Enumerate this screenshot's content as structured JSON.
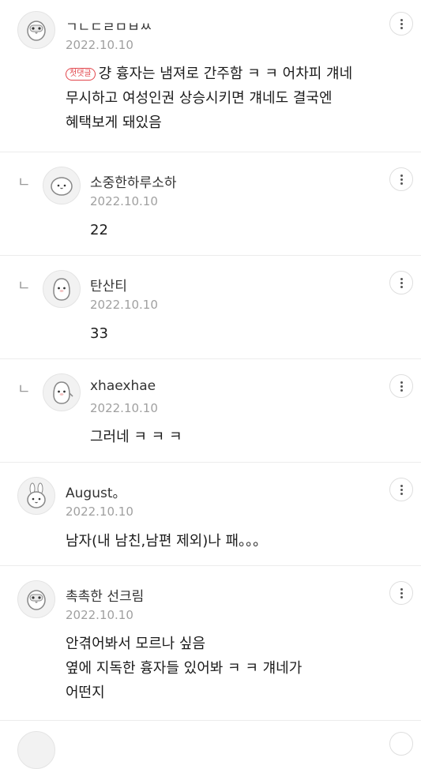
{
  "comments": [
    {
      "nick": "ㄱㄴㄷㄹㅁㅂㅆ",
      "date": "2022.10.10",
      "badge": "첫댓글",
      "text": "걍 흉자는 냄져로 간주함 ㅋ ㅋ 어차피 걔네\n무시하고 여성인권 상승시키면 걔네도 결국엔\n혜택보게 돼있음",
      "avatar_icon": "penguin-icon"
    },
    {
      "nick": "소중한하루소하",
      "date": "2022.10.10",
      "text": "22",
      "avatar_icon": "blob-icon"
    },
    {
      "nick": "탄산티",
      "date": "2022.10.10",
      "text": "33",
      "avatar_icon": "penguin-icon"
    },
    {
      "nick": "xhaexhae",
      "date": "2022.10.10",
      "text": "그러네 ㅋ ㅋ ㅋ",
      "avatar_icon": "penguin-icon"
    },
    {
      "nick": "August。",
      "date": "2022.10.10",
      "text": "남자(내 남친,남편 제외)나 패。。。",
      "avatar_icon": "rabbit-icon"
    },
    {
      "nick": "촉촉한 선크림",
      "date": "2022.10.10",
      "text": "안겪어봐서 모르나 싶음\n옆에 지독한 흉자들 있어봐 ㅋ ㅋ 걔네가\n어떤지",
      "avatar_icon": "penguin-icon"
    }
  ],
  "reply_mark": "ㄴ",
  "more_icon": "more-vertical-icon"
}
